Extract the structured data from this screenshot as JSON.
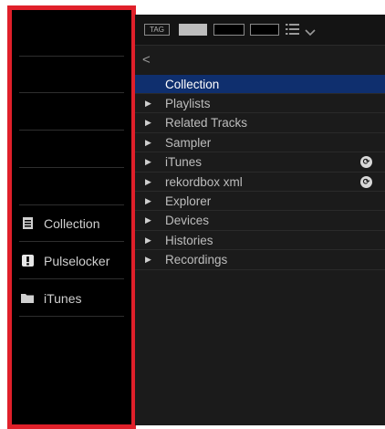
{
  "toolbar": {
    "tag_label": "TAG",
    "list_icon": "list-icon",
    "chevron_icon": "chevron-down-icon"
  },
  "back": {
    "label": "<"
  },
  "tree": [
    {
      "label": "Collection",
      "selected": true,
      "arrow": false,
      "sync": false
    },
    {
      "label": "Playlists",
      "selected": false,
      "arrow": true,
      "sync": false
    },
    {
      "label": "Related Tracks",
      "selected": false,
      "arrow": true,
      "sync": false
    },
    {
      "label": "Sampler",
      "selected": false,
      "arrow": true,
      "sync": false
    },
    {
      "label": "iTunes",
      "selected": false,
      "arrow": true,
      "sync": true
    },
    {
      "label": "rekordbox xml",
      "selected": false,
      "arrow": true,
      "sync": true
    },
    {
      "label": "Explorer",
      "selected": false,
      "arrow": true,
      "sync": false
    },
    {
      "label": "Devices",
      "selected": false,
      "arrow": true,
      "sync": false
    },
    {
      "label": "Histories",
      "selected": false,
      "arrow": true,
      "sync": false
    },
    {
      "label": "Recordings",
      "selected": false,
      "arrow": true,
      "sync": false
    }
  ],
  "left_nav": [
    {
      "label": "Collection",
      "icon": "collection-icon"
    },
    {
      "label": "Pulselocker",
      "icon": "pulselocker-icon"
    },
    {
      "label": "iTunes",
      "icon": "folder-icon"
    }
  ],
  "colors": {
    "highlight_border": "#e0202a",
    "selected_row": "#0f2f6e"
  }
}
